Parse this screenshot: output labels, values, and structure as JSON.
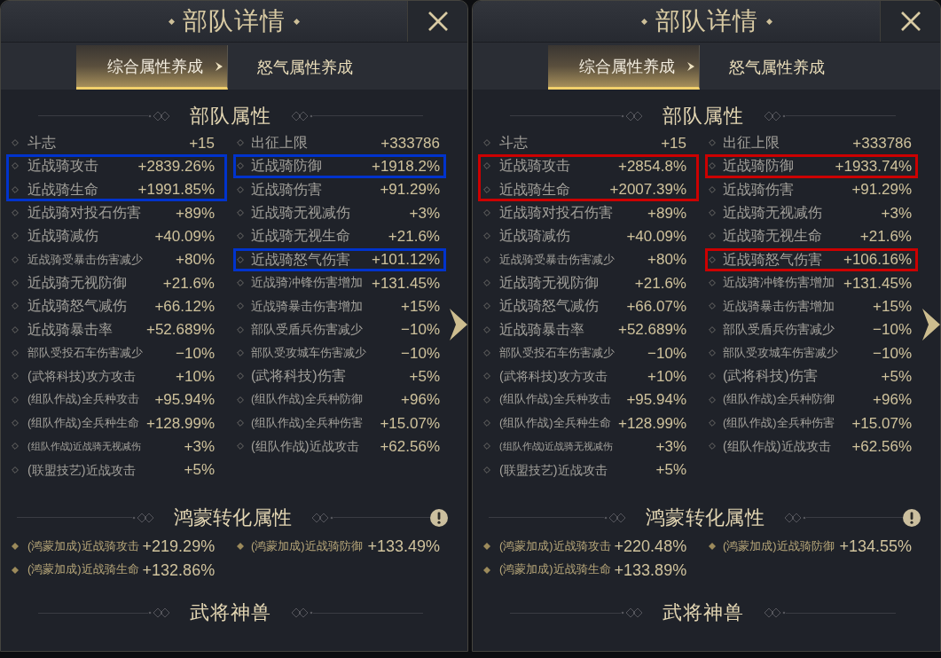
{
  "panels": [
    {
      "title": "部队详情",
      "color": "#0033cc",
      "tabs": [
        {
          "label": "综合属性养成",
          "selected": true
        },
        {
          "label": "怒气属性养成",
          "selected": false
        }
      ],
      "sections": [
        {
          "kind": "attributes",
          "heading": "部队属性",
          "columns": [
            [
              {
                "label": "斗志",
                "value": "+15",
                "highlighted": false
              },
              {
                "label": "近战骑攻击",
                "value": "+2839.26%",
                "highlighted": true
              },
              {
                "label": "近战骑生命",
                "value": "+1991.85%",
                "highlighted": true
              },
              {
                "label": "近战骑对投石伤害",
                "value": "+89%",
                "highlighted": false
              },
              {
                "label": "近战骑减伤",
                "value": "+40.09%",
                "highlighted": false
              },
              {
                "label": "近战骑受暴击伤害减少",
                "value": "+80%",
                "highlighted": false
              },
              {
                "label": "近战骑无视防御",
                "value": "+21.6%",
                "highlighted": false
              },
              {
                "label": "近战骑怒气减伤",
                "value": "+66.12%",
                "highlighted": false
              },
              {
                "label": "近战骑暴击率",
                "value": "+52.689%",
                "highlighted": false
              },
              {
                "label": "部队受投石车伤害减少",
                "value": "−10%",
                "highlighted": false
              },
              {
                "label": "(武将科技)攻方攻击",
                "value": "+10%",
                "highlighted": false
              },
              {
                "label": "(组队作战)全兵种攻击",
                "value": "+95.94%",
                "highlighted": false
              },
              {
                "label": "(组队作战)全兵种生命",
                "value": "+128.99%",
                "highlighted": false
              },
              {
                "label": "(组队作战)近战骑无视减伤",
                "value": "+3%",
                "highlighted": false
              },
              {
                "label": "(联盟技艺)近战攻击",
                "value": "+5%",
                "highlighted": false
              }
            ],
            [
              {
                "label": "出征上限",
                "value": "+333786",
                "highlighted": false
              },
              {
                "label": "近战骑防御",
                "value": "+1918.2%",
                "highlighted": true
              },
              {
                "label": "近战骑伤害",
                "value": "+91.29%",
                "highlighted": false
              },
              {
                "label": "近战骑无视减伤",
                "value": "+3%",
                "highlighted": false
              },
              {
                "label": "近战骑无视生命",
                "value": "+21.6%",
                "highlighted": false
              },
              {
                "label": "近战骑怒气伤害",
                "value": "+101.12%",
                "highlighted": true
              },
              {
                "label": "近战骑冲锋伤害增加",
                "value": "+131.45%",
                "highlighted": false
              },
              {
                "label": "近战骑暴击伤害增加",
                "value": "+15%",
                "highlighted": false
              },
              {
                "label": "部队受盾兵伤害减少",
                "value": "−10%",
                "highlighted": false
              },
              {
                "label": "部队受攻城车伤害减少",
                "value": "−10%",
                "highlighted": false
              },
              {
                "label": "(武将科技)伤害",
                "value": "+5%",
                "highlighted": false
              },
              {
                "label": "(组队作战)全兵种防御",
                "value": "+96%",
                "highlighted": false
              },
              {
                "label": "(组队作战)全兵种伤害",
                "value": "+15.07%",
                "highlighted": false
              },
              {
                "label": "(组队作战)近战攻击",
                "value": "+62.56%",
                "highlighted": false
              }
            ]
          ]
        },
        {
          "kind": "conversion",
          "heading": "鸿蒙转化属性",
          "columns": [
            [
              {
                "label": "(鸿蒙加成)近战骑攻击",
                "value": "+219.29%"
              },
              {
                "label": "(鸿蒙加成)近战骑生命",
                "value": "+132.86%"
              }
            ],
            [
              {
                "label": "(鸿蒙加成)近战骑防御",
                "value": "+133.49%"
              }
            ]
          ]
        },
        {
          "kind": "heading_only",
          "heading": "武将神兽"
        }
      ]
    },
    {
      "title": "部队详情",
      "color": "#cc0000",
      "tabs": [
        {
          "label": "综合属性养成",
          "selected": true
        },
        {
          "label": "怒气属性养成",
          "selected": false
        }
      ],
      "sections": [
        {
          "kind": "attributes",
          "heading": "部队属性",
          "columns": [
            [
              {
                "label": "斗志",
                "value": "+15",
                "highlighted": false
              },
              {
                "label": "近战骑攻击",
                "value": "+2854.8%",
                "highlighted": true
              },
              {
                "label": "近战骑生命",
                "value": "+2007.39%",
                "highlighted": true
              },
              {
                "label": "近战骑对投石伤害",
                "value": "+89%",
                "highlighted": false
              },
              {
                "label": "近战骑减伤",
                "value": "+40.09%",
                "highlighted": false
              },
              {
                "label": "近战骑受暴击伤害减少",
                "value": "+80%",
                "highlighted": false
              },
              {
                "label": "近战骑无视防御",
                "value": "+21.6%",
                "highlighted": false
              },
              {
                "label": "近战骑怒气减伤",
                "value": "+66.07%",
                "highlighted": false
              },
              {
                "label": "近战骑暴击率",
                "value": "+52.689%",
                "highlighted": false
              },
              {
                "label": "部队受投石车伤害减少",
                "value": "−10%",
                "highlighted": false
              },
              {
                "label": "(武将科技)攻方攻击",
                "value": "+10%",
                "highlighted": false
              },
              {
                "label": "(组队作战)全兵种攻击",
                "value": "+95.94%",
                "highlighted": false
              },
              {
                "label": "(组队作战)全兵种生命",
                "value": "+128.99%",
                "highlighted": false
              },
              {
                "label": "(组队作战)近战骑无视减伤",
                "value": "+3%",
                "highlighted": false
              },
              {
                "label": "(联盟技艺)近战攻击",
                "value": "+5%",
                "highlighted": false
              }
            ],
            [
              {
                "label": "出征上限",
                "value": "+333786",
                "highlighted": false
              },
              {
                "label": "近战骑防御",
                "value": "+1933.74%",
                "highlighted": true
              },
              {
                "label": "近战骑伤害",
                "value": "+91.29%",
                "highlighted": false
              },
              {
                "label": "近战骑无视减伤",
                "value": "+3%",
                "highlighted": false
              },
              {
                "label": "近战骑无视生命",
                "value": "+21.6%",
                "highlighted": false
              },
              {
                "label": "近战骑怒气伤害",
                "value": "+106.16%",
                "highlighted": true
              },
              {
                "label": "近战骑冲锋伤害增加",
                "value": "+131.45%",
                "highlighted": false
              },
              {
                "label": "近战骑暴击伤害增加",
                "value": "+15%",
                "highlighted": false
              },
              {
                "label": "部队受盾兵伤害减少",
                "value": "−10%",
                "highlighted": false
              },
              {
                "label": "部队受攻城车伤害减少",
                "value": "−10%",
                "highlighted": false
              },
              {
                "label": "(武将科技)伤害",
                "value": "+5%",
                "highlighted": false
              },
              {
                "label": "(组队作战)全兵种防御",
                "value": "+96%",
                "highlighted": false
              },
              {
                "label": "(组队作战)全兵种伤害",
                "value": "+15.07%",
                "highlighted": false
              },
              {
                "label": "(组队作战)近战攻击",
                "value": "+62.56%",
                "highlighted": false
              }
            ]
          ]
        },
        {
          "kind": "conversion",
          "heading": "鸿蒙转化属性",
          "columns": [
            [
              {
                "label": "(鸿蒙加成)近战骑攻击",
                "value": "+220.48%"
              },
              {
                "label": "(鸿蒙加成)近战骑生命",
                "value": "+133.89%"
              }
            ],
            [
              {
                "label": "(鸿蒙加成)近战骑防御",
                "value": "+134.55%"
              }
            ]
          ]
        },
        {
          "kind": "heading_only",
          "heading": "武将神兽"
        }
      ]
    }
  ]
}
